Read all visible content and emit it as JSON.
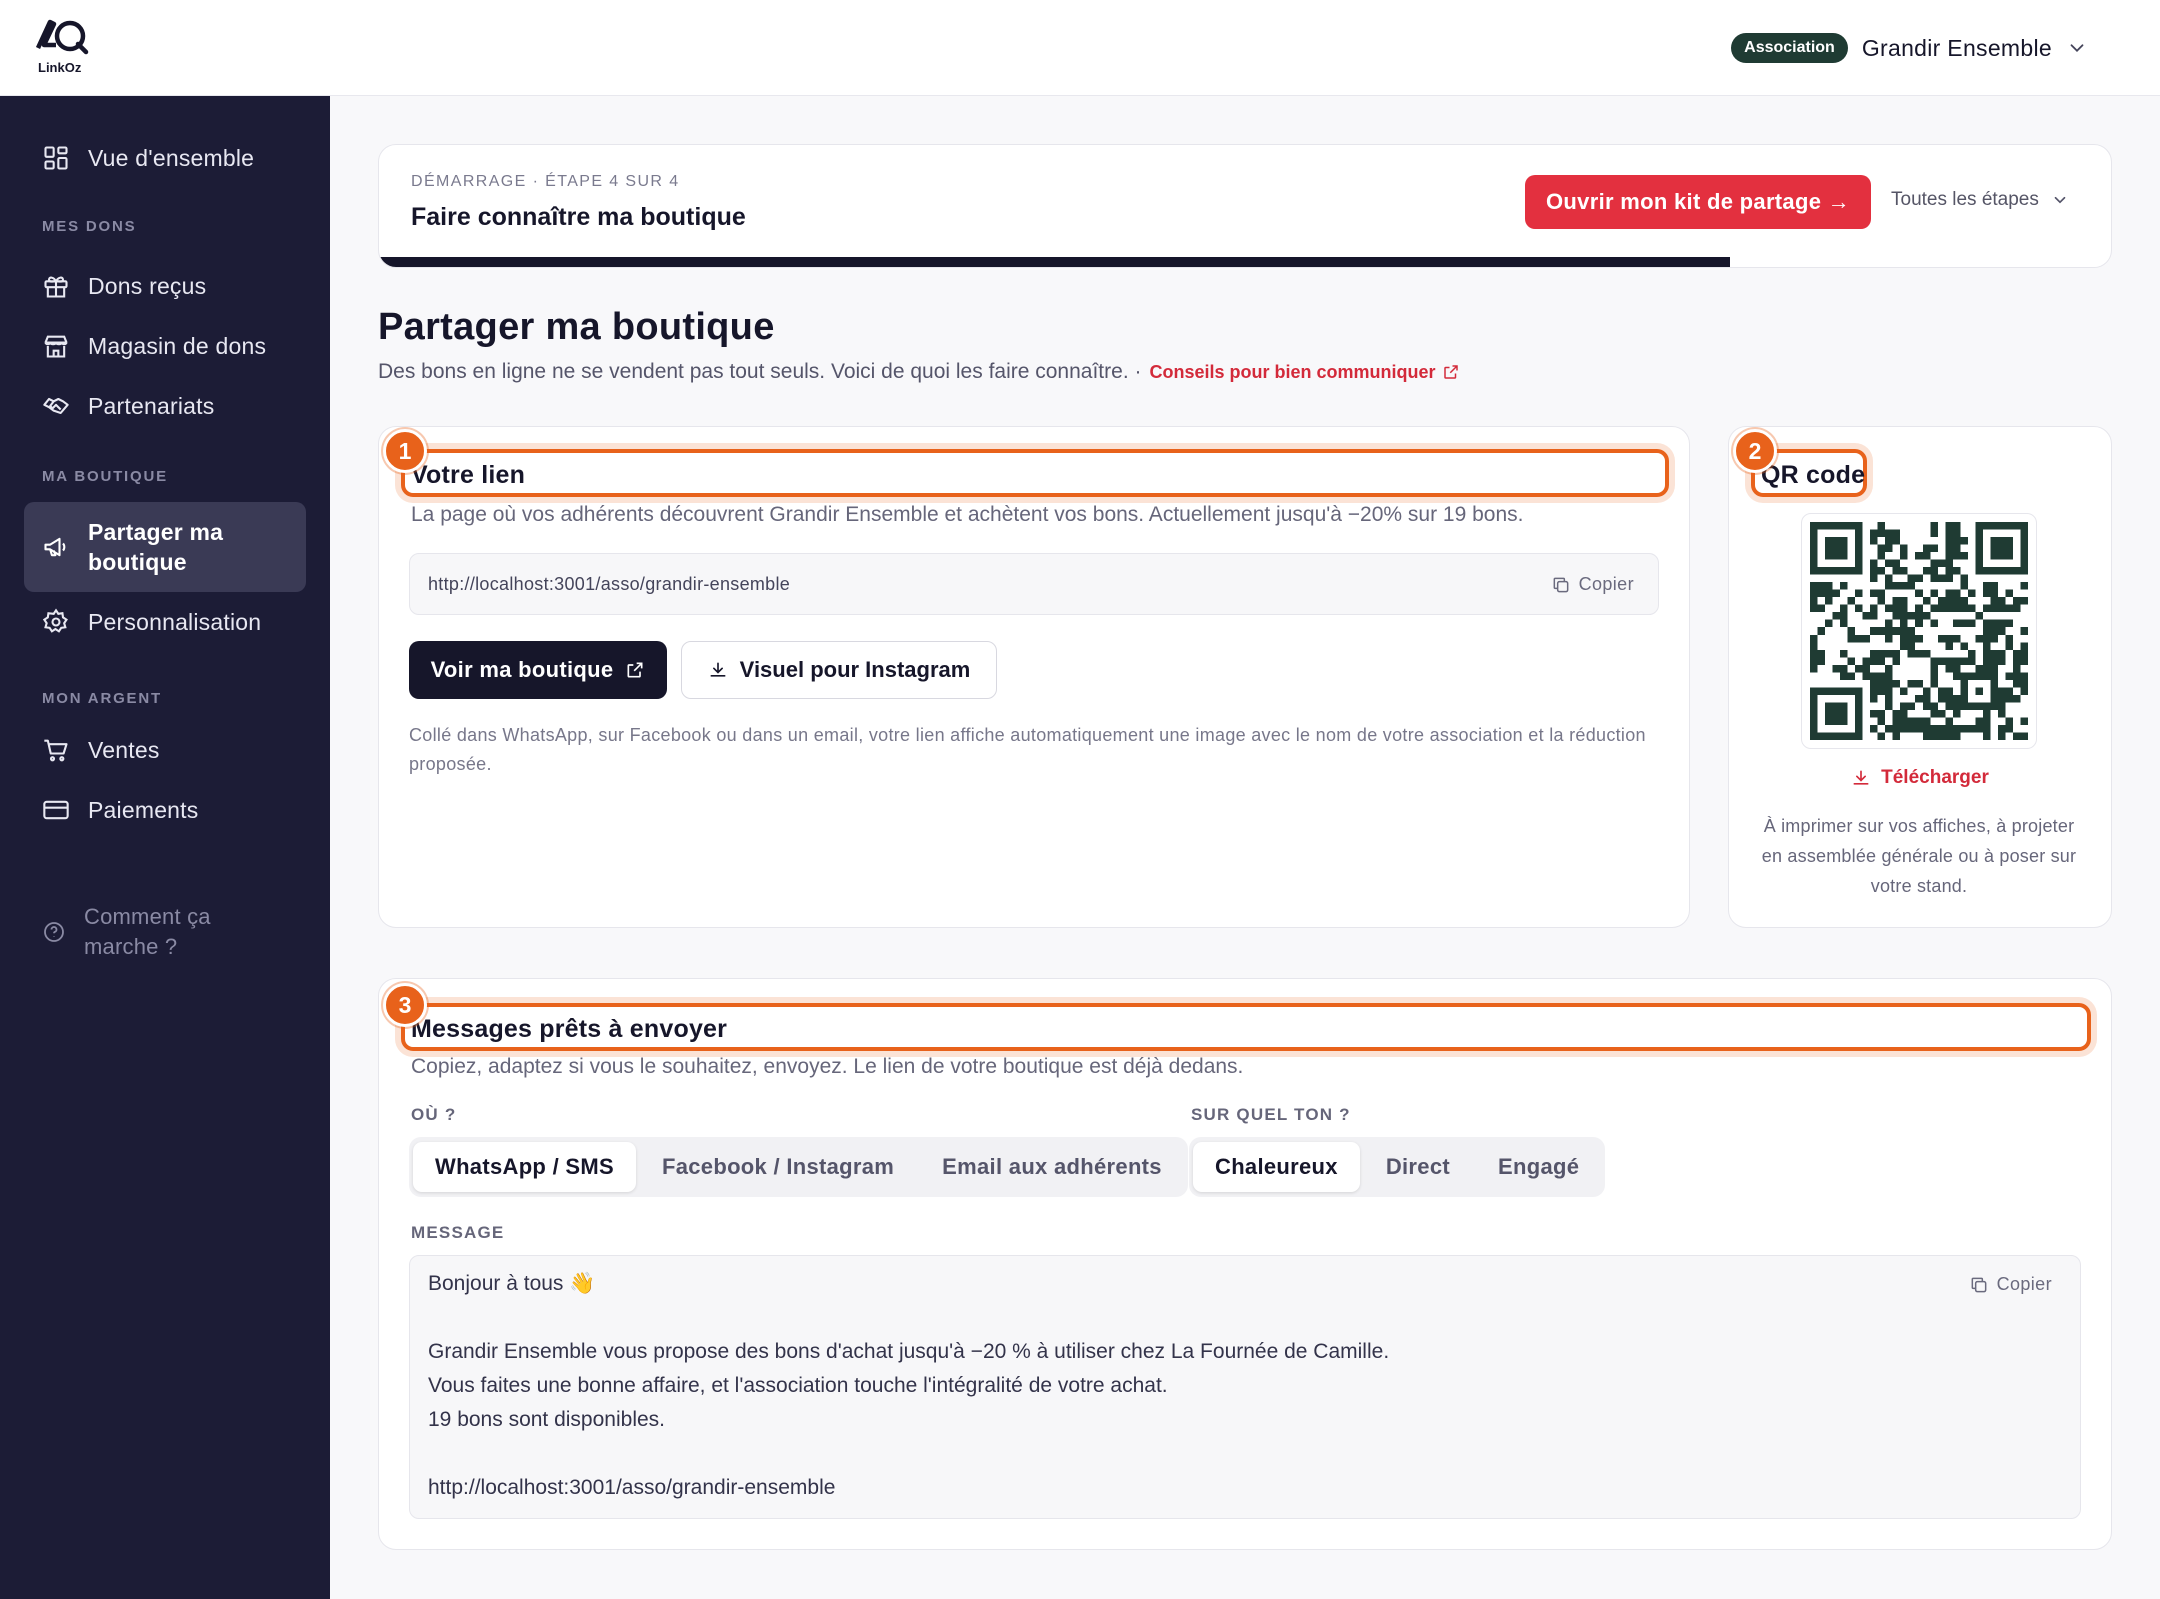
{
  "app": {
    "logo_text": "LinkOz"
  },
  "header": {
    "badge": "Association",
    "org_name": "Grandir Ensemble"
  },
  "sidebar": {
    "overview": "Vue d'ensemble",
    "section_dons": "MES DONS",
    "dons_recus": "Dons reçus",
    "magasin": "Magasin de dons",
    "partenariats": "Partenariats",
    "section_boutique": "MA BOUTIQUE",
    "partager_line1": "Partager ma",
    "partager_line2": "boutique",
    "personnalisation": "Personnalisation",
    "section_argent": "MON ARGENT",
    "ventes": "Ventes",
    "paiements": "Paiements",
    "help_line1": "Comment ça",
    "help_line2": "marche ?"
  },
  "step": {
    "kicker": "DÉMARRAGE · ÉTAPE 4 SUR 4",
    "title": "Faire connaître ma boutique",
    "cta": "Ouvrir mon kit de partage →",
    "all_steps": "Toutes les étapes",
    "progress": 0.78
  },
  "page": {
    "title": "Partager ma boutique",
    "subtitle": "Des bons en ligne ne se vendent pas tout seuls. Voici de quoi les faire connaître. ·",
    "tip": "Conseils pour bien communiquer"
  },
  "link_card": {
    "number": "1",
    "title": "Votre lien",
    "desc": "La page où vos adhérents découvrent Grandir Ensemble et achètent vos bons. Actuellement jusqu'à −20% sur 19 bons.",
    "url": "http://localhost:3001/asso/grandir-ensemble",
    "copy": "Copier",
    "view_btn": "Voir ma boutique",
    "insta_btn": "Visuel pour Instagram",
    "note": "Collé dans WhatsApp, sur Facebook ou dans un email, votre lien affiche automatiquement une image avec le nom de votre association et la réduction proposée."
  },
  "qr_card": {
    "number": "2",
    "title": "QR code",
    "download": "Télécharger",
    "note": "À imprimer sur vos affiches, à projeter en assemblée générale ou à poser sur votre stand."
  },
  "messages_card": {
    "number": "3",
    "title": "Messages prêts à envoyer",
    "desc": "Copiez, adaptez si vous le souhaitez, envoyez. Le lien de votre boutique est déjà dedans.",
    "where_label": "OÙ ?",
    "where_options": [
      "WhatsApp / SMS",
      "Facebook / Instagram",
      "Email aux adhérents"
    ],
    "tone_label": "SUR QUEL TON ?",
    "tone_options": [
      "Chaleureux",
      "Direct",
      "Engagé"
    ],
    "message_label": "MESSAGE",
    "copy": "Copier",
    "message_lines": [
      "Bonjour à tous 👋",
      "Grandir Ensemble vous propose des bons d'achat jusqu'à −20 % à utiliser chez La Fournée de Camille.",
      "Vous faites une bonne affaire, et l'association touche l'intégralité de votre achat.",
      "19 bons sont disponibles.",
      "http://localhost:3001/asso/grandir-ensemble"
    ]
  },
  "colors": {
    "accent_red": "#e3303f",
    "highlight_orange": "#e8621b",
    "sidebar_bg": "#1c1c36",
    "badge_green": "#1f3b33"
  }
}
